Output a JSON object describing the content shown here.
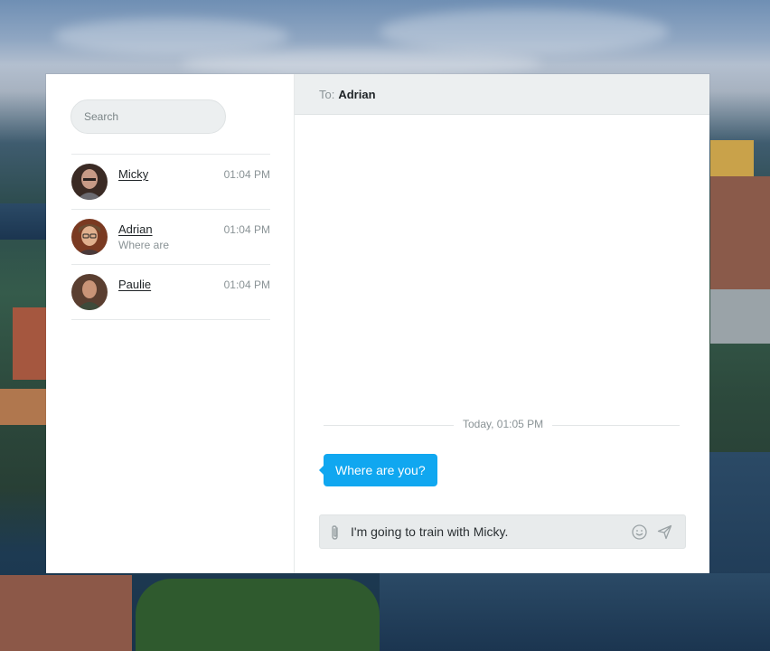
{
  "search": {
    "placeholder": "Search"
  },
  "contacts": [
    {
      "name": "Micky",
      "time": "01:04 PM",
      "preview": ""
    },
    {
      "name": "Adrian",
      "time": "01:04 PM",
      "preview": "Where are"
    },
    {
      "name": "Paulie",
      "time": "01:04 PM",
      "preview": ""
    }
  ],
  "chat": {
    "to_label": "To:",
    "recipient": "Adrian",
    "day_separator": "Today, 01:05 PM",
    "messages": [
      {
        "text": "Where are you?"
      }
    ],
    "composer_value": "I'm going to train with Micky."
  },
  "colors": {
    "accent": "#10a7f0",
    "header_bg": "#eceff0"
  },
  "icons": [
    "paperclip-icon",
    "emoji-icon",
    "send-icon"
  ]
}
